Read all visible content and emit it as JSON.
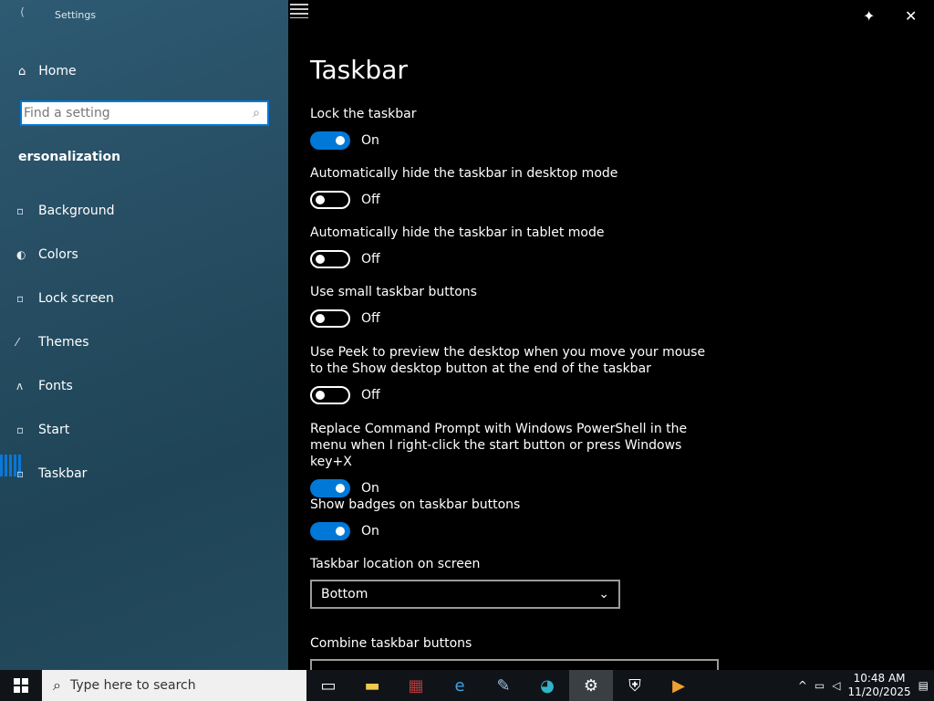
{
  "window": {
    "title": "Settings"
  },
  "left": {
    "home_label": "Home",
    "search_placeholder": "Find a setting",
    "section_label": "ersonalization",
    "nav": [
      {
        "label": "Background",
        "icon": "picture-icon"
      },
      {
        "label": "Colors",
        "icon": "palette-icon"
      },
      {
        "label": "Lock screen",
        "icon": "lock-screen-icon"
      },
      {
        "label": "Themes",
        "icon": "brush-icon"
      },
      {
        "label": "Fonts",
        "icon": "font-icon"
      },
      {
        "label": "Start",
        "icon": "start-icon"
      },
      {
        "label": "Taskbar",
        "icon": "taskbar-icon",
        "selected": true
      }
    ]
  },
  "main": {
    "title": "Taskbar",
    "settings": [
      {
        "label": "Lock the taskbar",
        "state": "On",
        "on": true
      },
      {
        "label": "Automatically hide the taskbar in desktop mode",
        "state": "Off",
        "on": false
      },
      {
        "label": "Automatically hide the taskbar in tablet mode",
        "state": "Off",
        "on": false
      },
      {
        "label": "Use small taskbar buttons",
        "state": "Off",
        "on": false
      },
      {
        "label": "Use Peek to preview the desktop when you move your mouse to the Show desktop button at the end of the taskbar",
        "state": "Off",
        "on": false
      },
      {
        "label": "Replace Command Prompt with Windows PowerShell in the menu when I right-click the start button or press Windows key+X",
        "state": "On",
        "on": true
      },
      {
        "label": "Show badges on taskbar buttons",
        "state": "On",
        "on": true
      }
    ],
    "location_label": "Taskbar location on screen",
    "location_value": "Bottom",
    "combine_label": "Combine taskbar buttons"
  },
  "taskbar": {
    "search_text": "Type here to search",
    "time": "10:48 AM",
    "date": "11/20/2025",
    "apps": [
      "task-view-icon",
      "file-explorer-icon",
      "winrar-icon",
      "internet-explorer-icon",
      "feather-app-icon",
      "edge-icon",
      "settings-gear-icon",
      "security-shield-icon",
      "media-player-icon"
    ]
  },
  "colors": {
    "accent": "#0078d7",
    "taskbar": "#101418",
    "left_pane": "#274e63"
  }
}
